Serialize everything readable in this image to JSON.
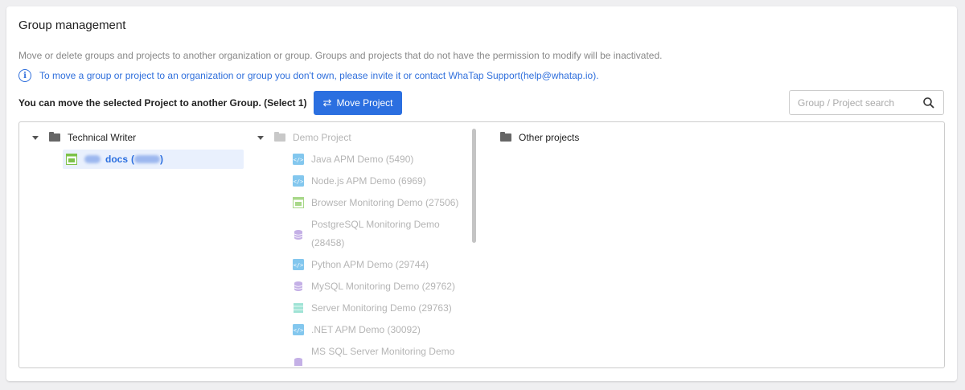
{
  "page": {
    "title": "Group management",
    "description": "Move or delete groups and projects to another organization or group. Groups and projects that do not have the permission to modify will be inactivated.",
    "info": "To move a group or project to an organization or group you don't own, please invite it or contact WhaTap Support(help@whatap.io).",
    "selection_text": "You can move the selected Project to another Group. (Select 1)",
    "move_button": "Move Project",
    "search_placeholder": "Group / Project search"
  },
  "left_tree": {
    "group": "Technical Writer",
    "selected_project": {
      "name": "docs",
      "paren_open": "(",
      "paren_close": ")"
    }
  },
  "middle_tree": {
    "group": "Demo Project",
    "projects": [
      {
        "label": "Java APM Demo (5490)",
        "icon": "apm-code-icon"
      },
      {
        "label": "Node.js APM Demo (6969)",
        "icon": "apm-code-icon"
      },
      {
        "label": "Browser Monitoring Demo (27506)",
        "icon": "browser-icon"
      },
      {
        "label": "PostgreSQL Monitoring Demo",
        "label2": "(28458)",
        "icon": "database-icon"
      },
      {
        "label": "Python APM Demo (29744)",
        "icon": "apm-code-icon"
      },
      {
        "label": "MySQL Monitoring Demo (29762)",
        "icon": "database-icon"
      },
      {
        "label": "Server Monitoring Demo (29763)",
        "icon": "server-icon"
      },
      {
        "label": ".NET APM Demo (30092)",
        "icon": "apm-code-icon"
      },
      {
        "label": "MS SQL Server Monitoring Demo",
        "icon": "database-icon"
      }
    ]
  },
  "right_tree": {
    "group": "Other projects"
  },
  "colors": {
    "accent": "#2b6fe0",
    "info_text": "#2f6fdc",
    "selected_bg": "#e9f0fd",
    "apm_icon": "#5ab4e8",
    "browser_icon": "#7dc24a",
    "database_icon": "#a98ad8",
    "server_icon": "#5fcfb8"
  }
}
